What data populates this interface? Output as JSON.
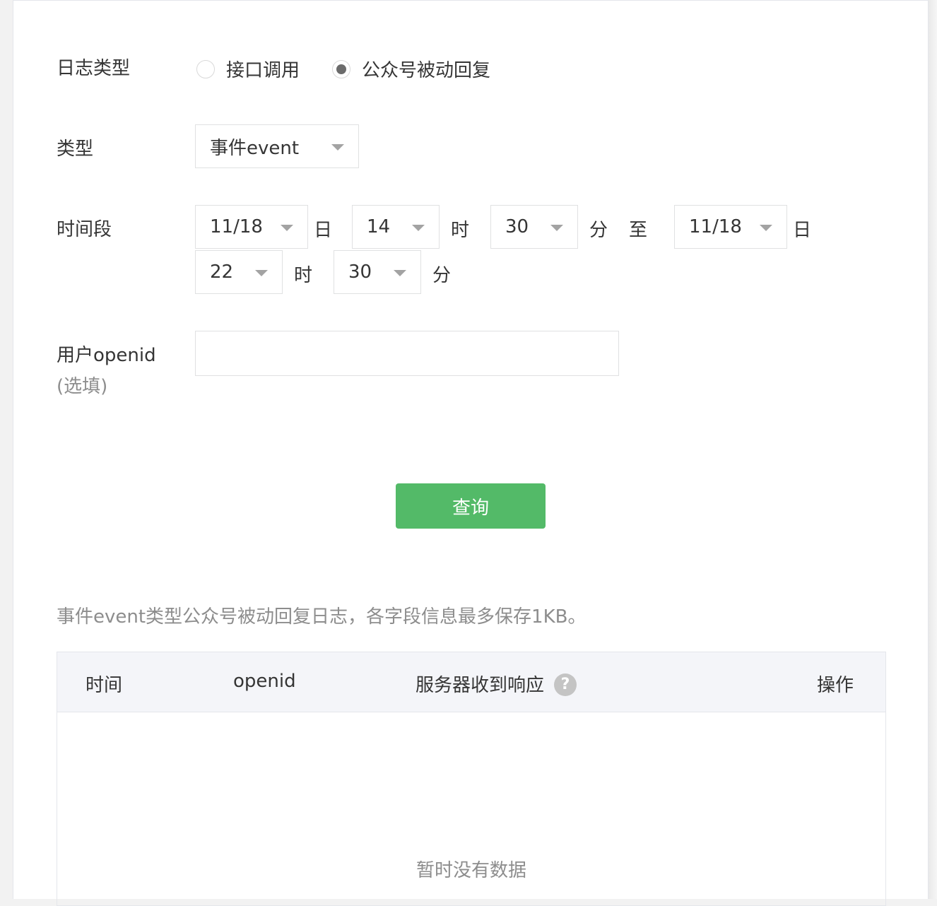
{
  "form": {
    "log_type_label": "日志类型",
    "log_type_options": [
      {
        "label": "接口调用",
        "checked": false
      },
      {
        "label": "公众号被动回复",
        "checked": true
      }
    ],
    "type_label": "类型",
    "type_value": "事件event",
    "period_label": "时间段",
    "start_date": "11/18",
    "start_hour": "14",
    "start_minute": "30",
    "end_date": "11/18",
    "end_hour": "22",
    "end_minute": "30",
    "unit_day": "日",
    "unit_hour": "时",
    "unit_minute": "分",
    "to_label": "至",
    "openid_label": "用户openid",
    "openid_optional": "(选填)",
    "openid_value": "",
    "query_button": "查询"
  },
  "result": {
    "tip": "事件event类型公众号被动回复日志，各字段信息最多保存1KB。",
    "columns": [
      "时间",
      "openid",
      "服务器收到响应",
      "操作"
    ],
    "empty_text": "暂时没有数据"
  },
  "colors": {
    "primary_button": "#53ba68",
    "header_bg": "#f4f5f9"
  },
  "icons": {
    "help": "question-circle-icon"
  }
}
